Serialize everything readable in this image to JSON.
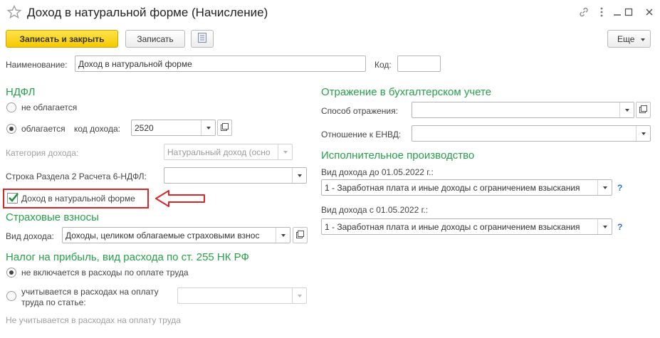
{
  "header": {
    "title": "Доход в натуральной форме (Начисление)"
  },
  "toolbar": {
    "save_close": "Записать и закрыть",
    "save": "Записать",
    "more": "Еще"
  },
  "main": {
    "name_label": "Наименование:",
    "name_value": "Доход в натуральной форме",
    "code_label": "Код:",
    "code_value": ""
  },
  "ndfl": {
    "section": "НДФЛ",
    "not_taxed": "не облагается",
    "taxed": "облагается",
    "income_code_label": "код дохода:",
    "income_code_value": "2520",
    "category_label": "Категория дохода:",
    "category_value": "Натуральный доход (осно",
    "row6_label": "Строка Раздела 2 Расчета 6-НДФЛ:",
    "row6_value": "",
    "in_kind_checkbox": "Доход в натуральной форме",
    "in_kind_checked": true
  },
  "insurance": {
    "section": "Страховые взносы",
    "income_type_label": "Вид дохода:",
    "income_type_value": "Доходы, целиком облагаемые страховыми взнос"
  },
  "profit_tax": {
    "section": "Налог на прибыль, вид расхода по ст. 255 НК РФ",
    "not_included": "не включается в расходы по оплате труда",
    "included_line1": "учитывается в расходах на оплату",
    "included_line2": "труда по статье:",
    "article_value": "",
    "note": "Не учитывается в расходах на оплату труда"
  },
  "accounting": {
    "section": "Отражение в бухгалтерском учете",
    "method_label": "Способ отражения:",
    "method_value": "",
    "envd_label": "Отношение к ЕНВД:",
    "envd_value": ""
  },
  "enforcement": {
    "section": "Исполнительное производство",
    "before_label": "Вид дохода до 01.05.2022 г.:",
    "before_value": "1 - Заработная плата и иные доходы с ограничением взыскания",
    "after_label": "Вид дохода с 01.05.2022 г.:",
    "after_value": "1 - Заработная плата и иные доходы с ограничением взыскания",
    "help": "?"
  },
  "colors": {
    "section_green": "#27a04a",
    "primary_yellow": "#f5c900",
    "highlight_red": "#d9262a",
    "help_blue": "#2a6ed8"
  }
}
